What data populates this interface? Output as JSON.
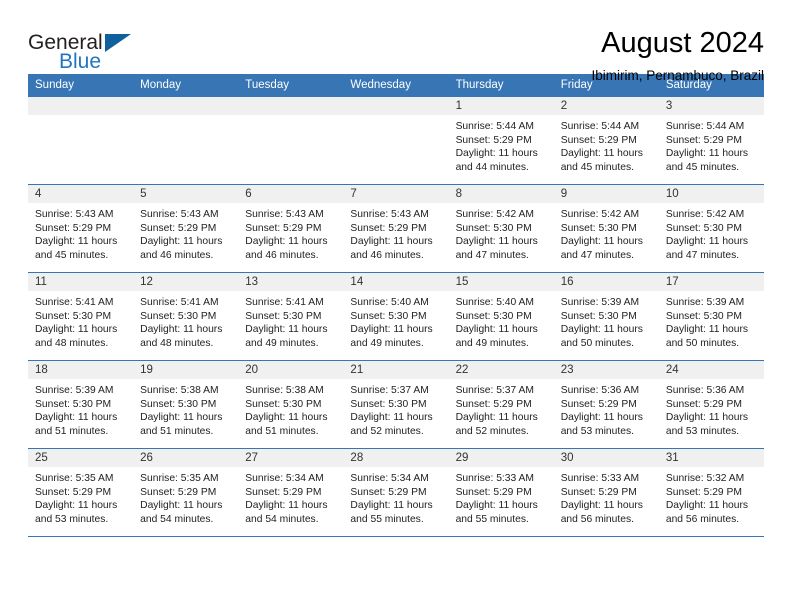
{
  "brand": {
    "name_top": "General",
    "name_bottom": "Blue",
    "triangle_color": "#10609e",
    "blue_color": "#2176bd"
  },
  "header": {
    "title": "August 2024",
    "subtitle": "Ibimirim, Pernambuco, Brazil"
  },
  "theme": {
    "header_row_bg": "#3775b5",
    "daynum_band_bg": "#f0f0f0",
    "grid_line": "#3775b5"
  },
  "weekday_headers": [
    "Sunday",
    "Monday",
    "Tuesday",
    "Wednesday",
    "Thursday",
    "Friday",
    "Saturday"
  ],
  "labels": {
    "sunrise_prefix": "Sunrise:",
    "sunset_prefix": "Sunset:",
    "daylight_prefix": "Daylight:"
  },
  "weeks": [
    [
      {
        "empty": true
      },
      {
        "empty": true
      },
      {
        "empty": true
      },
      {
        "empty": true
      },
      {
        "day": "1",
        "sunrise": "Sunrise: 5:44 AM",
        "sunset": "Sunset: 5:29 PM",
        "daylight": "Daylight: 11 hours and 44 minutes."
      },
      {
        "day": "2",
        "sunrise": "Sunrise: 5:44 AM",
        "sunset": "Sunset: 5:29 PM",
        "daylight": "Daylight: 11 hours and 45 minutes."
      },
      {
        "day": "3",
        "sunrise": "Sunrise: 5:44 AM",
        "sunset": "Sunset: 5:29 PM",
        "daylight": "Daylight: 11 hours and 45 minutes."
      }
    ],
    [
      {
        "day": "4",
        "sunrise": "Sunrise: 5:43 AM",
        "sunset": "Sunset: 5:29 PM",
        "daylight": "Daylight: 11 hours and 45 minutes."
      },
      {
        "day": "5",
        "sunrise": "Sunrise: 5:43 AM",
        "sunset": "Sunset: 5:29 PM",
        "daylight": "Daylight: 11 hours and 46 minutes."
      },
      {
        "day": "6",
        "sunrise": "Sunrise: 5:43 AM",
        "sunset": "Sunset: 5:29 PM",
        "daylight": "Daylight: 11 hours and 46 minutes."
      },
      {
        "day": "7",
        "sunrise": "Sunrise: 5:43 AM",
        "sunset": "Sunset: 5:29 PM",
        "daylight": "Daylight: 11 hours and 46 minutes."
      },
      {
        "day": "8",
        "sunrise": "Sunrise: 5:42 AM",
        "sunset": "Sunset: 5:30 PM",
        "daylight": "Daylight: 11 hours and 47 minutes."
      },
      {
        "day": "9",
        "sunrise": "Sunrise: 5:42 AM",
        "sunset": "Sunset: 5:30 PM",
        "daylight": "Daylight: 11 hours and 47 minutes."
      },
      {
        "day": "10",
        "sunrise": "Sunrise: 5:42 AM",
        "sunset": "Sunset: 5:30 PM",
        "daylight": "Daylight: 11 hours and 47 minutes."
      }
    ],
    [
      {
        "day": "11",
        "sunrise": "Sunrise: 5:41 AM",
        "sunset": "Sunset: 5:30 PM",
        "daylight": "Daylight: 11 hours and 48 minutes."
      },
      {
        "day": "12",
        "sunrise": "Sunrise: 5:41 AM",
        "sunset": "Sunset: 5:30 PM",
        "daylight": "Daylight: 11 hours and 48 minutes."
      },
      {
        "day": "13",
        "sunrise": "Sunrise: 5:41 AM",
        "sunset": "Sunset: 5:30 PM",
        "daylight": "Daylight: 11 hours and 49 minutes."
      },
      {
        "day": "14",
        "sunrise": "Sunrise: 5:40 AM",
        "sunset": "Sunset: 5:30 PM",
        "daylight": "Daylight: 11 hours and 49 minutes."
      },
      {
        "day": "15",
        "sunrise": "Sunrise: 5:40 AM",
        "sunset": "Sunset: 5:30 PM",
        "daylight": "Daylight: 11 hours and 49 minutes."
      },
      {
        "day": "16",
        "sunrise": "Sunrise: 5:39 AM",
        "sunset": "Sunset: 5:30 PM",
        "daylight": "Daylight: 11 hours and 50 minutes."
      },
      {
        "day": "17",
        "sunrise": "Sunrise: 5:39 AM",
        "sunset": "Sunset: 5:30 PM",
        "daylight": "Daylight: 11 hours and 50 minutes."
      }
    ],
    [
      {
        "day": "18",
        "sunrise": "Sunrise: 5:39 AM",
        "sunset": "Sunset: 5:30 PM",
        "daylight": "Daylight: 11 hours and 51 minutes."
      },
      {
        "day": "19",
        "sunrise": "Sunrise: 5:38 AM",
        "sunset": "Sunset: 5:30 PM",
        "daylight": "Daylight: 11 hours and 51 minutes."
      },
      {
        "day": "20",
        "sunrise": "Sunrise: 5:38 AM",
        "sunset": "Sunset: 5:30 PM",
        "daylight": "Daylight: 11 hours and 51 minutes."
      },
      {
        "day": "21",
        "sunrise": "Sunrise: 5:37 AM",
        "sunset": "Sunset: 5:30 PM",
        "daylight": "Daylight: 11 hours and 52 minutes."
      },
      {
        "day": "22",
        "sunrise": "Sunrise: 5:37 AM",
        "sunset": "Sunset: 5:29 PM",
        "daylight": "Daylight: 11 hours and 52 minutes."
      },
      {
        "day": "23",
        "sunrise": "Sunrise: 5:36 AM",
        "sunset": "Sunset: 5:29 PM",
        "daylight": "Daylight: 11 hours and 53 minutes."
      },
      {
        "day": "24",
        "sunrise": "Sunrise: 5:36 AM",
        "sunset": "Sunset: 5:29 PM",
        "daylight": "Daylight: 11 hours and 53 minutes."
      }
    ],
    [
      {
        "day": "25",
        "sunrise": "Sunrise: 5:35 AM",
        "sunset": "Sunset: 5:29 PM",
        "daylight": "Daylight: 11 hours and 53 minutes."
      },
      {
        "day": "26",
        "sunrise": "Sunrise: 5:35 AM",
        "sunset": "Sunset: 5:29 PM",
        "daylight": "Daylight: 11 hours and 54 minutes."
      },
      {
        "day": "27",
        "sunrise": "Sunrise: 5:34 AM",
        "sunset": "Sunset: 5:29 PM",
        "daylight": "Daylight: 11 hours and 54 minutes."
      },
      {
        "day": "28",
        "sunrise": "Sunrise: 5:34 AM",
        "sunset": "Sunset: 5:29 PM",
        "daylight": "Daylight: 11 hours and 55 minutes."
      },
      {
        "day": "29",
        "sunrise": "Sunrise: 5:33 AM",
        "sunset": "Sunset: 5:29 PM",
        "daylight": "Daylight: 11 hours and 55 minutes."
      },
      {
        "day": "30",
        "sunrise": "Sunrise: 5:33 AM",
        "sunset": "Sunset: 5:29 PM",
        "daylight": "Daylight: 11 hours and 56 minutes."
      },
      {
        "day": "31",
        "sunrise": "Sunrise: 5:32 AM",
        "sunset": "Sunset: 5:29 PM",
        "daylight": "Daylight: 11 hours and 56 minutes."
      }
    ]
  ]
}
